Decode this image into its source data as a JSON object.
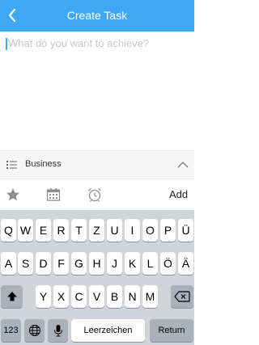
{
  "header": {
    "title": "Create Task",
    "back_icon": "chevron-left-icon",
    "background": "#3fa8f4"
  },
  "task_input": {
    "placeholder": "What do you want to achieve?"
  },
  "category": {
    "label": "Business",
    "list_icon": "list-icon",
    "toggle_icon": "chevron-up-icon"
  },
  "toolbar": {
    "icons": [
      "star-icon",
      "calendar-icon",
      "alarm-clock-icon"
    ],
    "add_label": "Add"
  },
  "keyboard": {
    "row1": [
      "Q",
      "W",
      "E",
      "R",
      "T",
      "Z",
      "U",
      "I",
      "O",
      "P",
      "Ü"
    ],
    "row2": [
      "A",
      "S",
      "D",
      "F",
      "G",
      "H",
      "J",
      "K",
      "L",
      "Ö",
      "Ä"
    ],
    "row3": [
      "Y",
      "X",
      "C",
      "V",
      "B",
      "N",
      "M"
    ],
    "numbers_label": "123",
    "space_label": "Leerzeichen",
    "return_label": "Return"
  }
}
